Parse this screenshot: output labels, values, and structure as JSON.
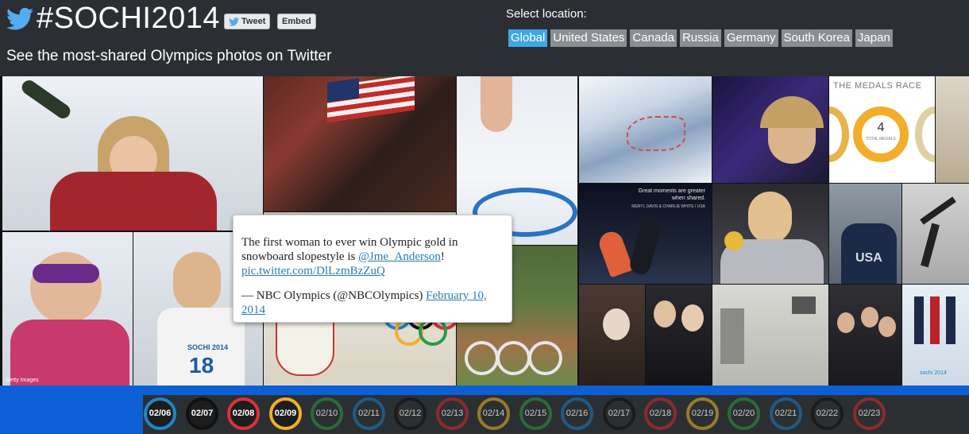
{
  "header": {
    "hashtag": "#SOCHI2014",
    "tweet_label": "Tweet",
    "embed_label": "Embed",
    "subtitle": "See the most-shared Olympics photos on Twitter"
  },
  "location": {
    "label": "Select location:",
    "options": [
      "Global",
      "United States",
      "Canada",
      "Russia",
      "Germany",
      "South Korea",
      "Japan"
    ],
    "selected": "Global"
  },
  "photos": {
    "medals_title": "THE MEDALS RACE",
    "medals_center": "4",
    "medals_sub": "TOTAL MEDALS",
    "moments_line1": "Great moments are greater",
    "moments_line2": "when shared.",
    "moments_names": "MERYL DAVIS & CHARLIE WHITE / USA",
    "bib_text": "SOCHI 2014",
    "bib_number": "18",
    "usa_text": "USA",
    "sochi_logo": "sochi 2014",
    "credit": "Getty Images"
  },
  "tweet": {
    "text_before": "The first woman to ever win Olympic gold in snowboard slopestyle is ",
    "mention": "@Jme_Anderson",
    "text_after": "!",
    "pic_link": "pic.twitter.com/DlLzmBzZuQ",
    "attribution": "— NBC Olympics (@NBCOlympics) ",
    "date_link": "February 10, 2014"
  },
  "timeline": {
    "days": [
      {
        "label": "02/06",
        "color": "#1f86c7",
        "active": true
      },
      {
        "label": "02/07",
        "color": "#111111",
        "active": true
      },
      {
        "label": "02/08",
        "color": "#d8323c",
        "active": true
      },
      {
        "label": "02/09",
        "color": "#f2ae2a",
        "active": true
      },
      {
        "label": "02/10",
        "color": "#2a6b3a",
        "active": false
      },
      {
        "label": "02/11",
        "color": "#1f5a86",
        "active": false
      },
      {
        "label": "02/12",
        "color": "#1b1b1b",
        "active": false
      },
      {
        "label": "02/13",
        "color": "#8a2a30",
        "active": false
      },
      {
        "label": "02/14",
        "color": "#9a7a2a",
        "active": false
      },
      {
        "label": "02/15",
        "color": "#2a6b3a",
        "active": false
      },
      {
        "label": "02/16",
        "color": "#1f5a86",
        "active": false
      },
      {
        "label": "02/17",
        "color": "#1b1b1b",
        "active": false
      },
      {
        "label": "02/18",
        "color": "#8a2a30",
        "active": false
      },
      {
        "label": "02/19",
        "color": "#9a7a2a",
        "active": false
      },
      {
        "label": "02/20",
        "color": "#2a6b3a",
        "active": false
      },
      {
        "label": "02/21",
        "color": "#1f5a86",
        "active": false
      },
      {
        "label": "02/22",
        "color": "#1b1b1b",
        "active": false
      },
      {
        "label": "02/23",
        "color": "#8a2a30",
        "active": false
      }
    ]
  },
  "colors": {
    "accent_blue": "#3fa7e8",
    "timeline_blue": "#0d5fd6",
    "link": "#2a7bb6"
  }
}
